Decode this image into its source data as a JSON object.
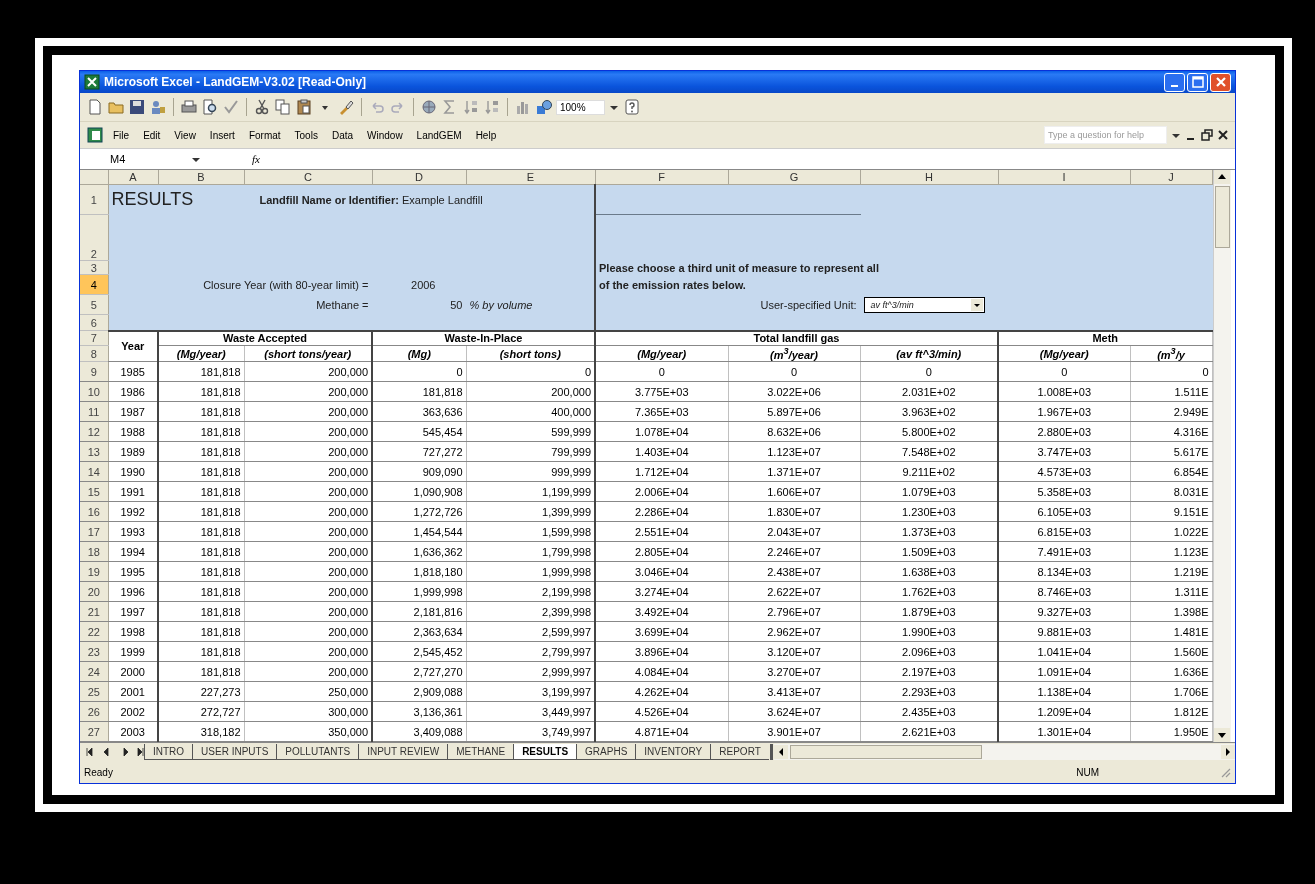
{
  "window": {
    "title": "Microsoft Excel - LandGEM-V3.02  [Read-Only]"
  },
  "toolbar": {
    "zoom": "100%"
  },
  "menu": [
    "File",
    "Edit",
    "View",
    "Insert",
    "Format",
    "Tools",
    "Data",
    "Window",
    "LandGEM",
    "Help"
  ],
  "help_search": {
    "placeholder": "Type a question for help"
  },
  "formula_bar": {
    "name_box": "M4",
    "function_label": "fx"
  },
  "columns": [
    "A",
    "B",
    "C",
    "D",
    "E",
    "F",
    "G",
    "H",
    "I",
    "J"
  ],
  "top_rows": [
    {
      "label": "1",
      "selected": false
    },
    {
      "label": "2",
      "selected": false
    },
    {
      "label": "3",
      "selected": false
    },
    {
      "label": "4",
      "selected": true
    },
    {
      "label": "5",
      "selected": false
    },
    {
      "label": "6",
      "selected": false
    },
    {
      "label": "7",
      "selected": false
    },
    {
      "label": "8",
      "selected": false
    }
  ],
  "sheet": {
    "title": "RESULTS",
    "name_label": "Landfill Name or Identifier:",
    "name_value": "Example Landfill",
    "closure_label": "Closure Year (with 80-year limit) =",
    "closure_value": "2006",
    "methane_label": "Methane =",
    "methane_value": "50",
    "methane_unit": "% by volume",
    "unit_prompt_lines": [
      "Please choose a third unit of measure to represent all",
      "of the emission rates below."
    ],
    "unit_label": "User-specified Unit:",
    "unit_value": "av ft^3/min"
  },
  "table_header": {
    "year": "Year",
    "groups": [
      {
        "label": "Waste Accepted",
        "units": [
          "(Mg/year)",
          "(short tons/year)"
        ]
      },
      {
        "label": "Waste-In-Place",
        "units": [
          "(Mg)",
          "(short tons)"
        ]
      },
      {
        "label": "Total landfill gas",
        "units": [
          "(Mg/year)",
          "(m$^{3}$/year)",
          "(av ft^3/min)"
        ]
      },
      {
        "label": "Meth",
        "units": [
          "(Mg/year)",
          "(m$^{3}$/y"
        ]
      }
    ]
  },
  "rows": [
    {
      "row": "9",
      "selected": false,
      "cells": [
        "1985",
        "181,818",
        "200,000",
        "0",
        "0",
        "0",
        "0",
        "0",
        "0",
        "0"
      ]
    },
    {
      "row": "10",
      "selected": false,
      "cells": [
        "1986",
        "181,818",
        "200,000",
        "181,818",
        "200,000",
        "3.775E+03",
        "3.022E+06",
        "2.031E+02",
        "1.008E+03",
        "1.511E"
      ]
    },
    {
      "row": "11",
      "selected": false,
      "cells": [
        "1987",
        "181,818",
        "200,000",
        "363,636",
        "400,000",
        "7.365E+03",
        "5.897E+06",
        "3.963E+02",
        "1.967E+03",
        "2.949E"
      ]
    },
    {
      "row": "12",
      "selected": false,
      "cells": [
        "1988",
        "181,818",
        "200,000",
        "545,454",
        "599,999",
        "1.078E+04",
        "8.632E+06",
        "5.800E+02",
        "2.880E+03",
        "4.316E"
      ]
    },
    {
      "row": "13",
      "selected": false,
      "cells": [
        "1989",
        "181,818",
        "200,000",
        "727,272",
        "799,999",
        "1.403E+04",
        "1.123E+07",
        "7.548E+02",
        "3.747E+03",
        "5.617E"
      ]
    },
    {
      "row": "14",
      "selected": false,
      "cells": [
        "1990",
        "181,818",
        "200,000",
        "909,090",
        "999,999",
        "1.712E+04",
        "1.371E+07",
        "9.211E+02",
        "4.573E+03",
        "6.854E"
      ]
    },
    {
      "row": "15",
      "selected": false,
      "cells": [
        "1991",
        "181,818",
        "200,000",
        "1,090,908",
        "1,199,999",
        "2.006E+04",
        "1.606E+07",
        "1.079E+03",
        "5.358E+03",
        "8.031E"
      ]
    },
    {
      "row": "16",
      "selected": false,
      "cells": [
        "1992",
        "181,818",
        "200,000",
        "1,272,726",
        "1,399,999",
        "2.286E+04",
        "1.830E+07",
        "1.230E+03",
        "6.105E+03",
        "9.151E"
      ]
    },
    {
      "row": "17",
      "selected": false,
      "cells": [
        "1993",
        "181,818",
        "200,000",
        "1,454,544",
        "1,599,998",
        "2.551E+04",
        "2.043E+07",
        "1.373E+03",
        "6.815E+03",
        "1.022E"
      ]
    },
    {
      "row": "18",
      "selected": false,
      "cells": [
        "1994",
        "181,818",
        "200,000",
        "1,636,362",
        "1,799,998",
        "2.805E+04",
        "2.246E+07",
        "1.509E+03",
        "7.491E+03",
        "1.123E"
      ]
    },
    {
      "row": "19",
      "selected": false,
      "cells": [
        "1995",
        "181,818",
        "200,000",
        "1,818,180",
        "1,999,998",
        "3.046E+04",
        "2.438E+07",
        "1.638E+03",
        "8.134E+03",
        "1.219E"
      ]
    },
    {
      "row": "20",
      "selected": false,
      "cells": [
        "1996",
        "181,818",
        "200,000",
        "1,999,998",
        "2,199,998",
        "3.274E+04",
        "2.622E+07",
        "1.762E+03",
        "8.746E+03",
        "1.311E"
      ]
    },
    {
      "row": "21",
      "selected": false,
      "cells": [
        "1997",
        "181,818",
        "200,000",
        "2,181,816",
        "2,399,998",
        "3.492E+04",
        "2.796E+07",
        "1.879E+03",
        "9.327E+03",
        "1.398E"
      ]
    },
    {
      "row": "22",
      "selected": false,
      "cells": [
        "1998",
        "181,818",
        "200,000",
        "2,363,634",
        "2,599,997",
        "3.699E+04",
        "2.962E+07",
        "1.990E+03",
        "9.881E+03",
        "1.481E"
      ]
    },
    {
      "row": "23",
      "selected": false,
      "cells": [
        "1999",
        "181,818",
        "200,000",
        "2,545,452",
        "2,799,997",
        "3.896E+04",
        "3.120E+07",
        "2.096E+03",
        "1.041E+04",
        "1.560E"
      ]
    },
    {
      "row": "24",
      "selected": false,
      "cells": [
        "2000",
        "181,818",
        "200,000",
        "2,727,270",
        "2,999,997",
        "4.084E+04",
        "3.270E+07",
        "2.197E+03",
        "1.091E+04",
        "1.636E"
      ]
    },
    {
      "row": "25",
      "selected": false,
      "cells": [
        "2001",
        "227,273",
        "250,000",
        "2,909,088",
        "3,199,997",
        "4.262E+04",
        "3.413E+07",
        "2.293E+03",
        "1.138E+04",
        "1.706E"
      ]
    },
    {
      "row": "26",
      "selected": false,
      "cells": [
        "2002",
        "272,727",
        "300,000",
        "3,136,361",
        "3,449,997",
        "4.526E+04",
        "3.624E+07",
        "2.435E+03",
        "1.209E+04",
        "1.812E"
      ]
    },
    {
      "row": "27",
      "selected": false,
      "cells": [
        "2003",
        "318,182",
        "350,000",
        "3,409,088",
        "3,749,997",
        "4.871E+04",
        "3.901E+07",
        "2.621E+03",
        "1.301E+04",
        "1.950E"
      ]
    }
  ],
  "sheet_tabs": [
    {
      "label": "INTRO",
      "selected": false
    },
    {
      "label": "USER INPUTS",
      "selected": false
    },
    {
      "label": "POLLUTANTS",
      "selected": false
    },
    {
      "label": "INPUT REVIEW",
      "selected": false
    },
    {
      "label": "METHANE",
      "selected": false
    },
    {
      "label": "RESULTS",
      "selected": true
    },
    {
      "label": "GRAPHS",
      "selected": false
    },
    {
      "label": "INVENTORY",
      "selected": false
    },
    {
      "label": "REPORT",
      "selected": false
    }
  ],
  "status_bar": {
    "message": "Ready",
    "indicator": "NUM"
  }
}
